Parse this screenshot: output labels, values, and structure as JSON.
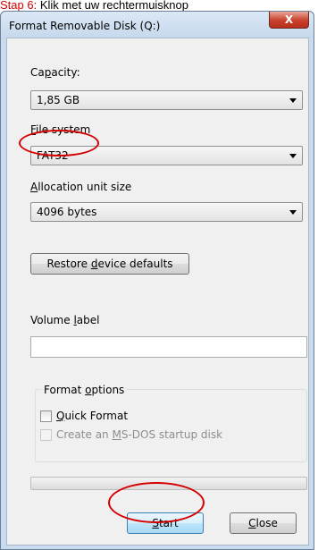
{
  "caption": {
    "step_prefix": "Stap 6:",
    "step_text": "Klik met uw rechtermuisknop"
  },
  "window": {
    "title": "Format Removable Disk (Q:)",
    "close_symbol": "X"
  },
  "capacity": {
    "label_pre": "Ca",
    "label_u": "p",
    "label_post": "acity:",
    "value": "1,85 GB"
  },
  "file_system": {
    "label_pre": "",
    "label_u": "F",
    "label_post": "ile system",
    "value": "FAT32"
  },
  "allocation": {
    "label_pre": "",
    "label_u": "A",
    "label_post": "llocation unit size",
    "value": "4096 bytes"
  },
  "restore": {
    "pre": "Restore ",
    "u": "d",
    "post": "evice defaults"
  },
  "volume": {
    "label_pre": "Volume ",
    "label_u": "l",
    "label_post": "abel",
    "value": ""
  },
  "format_options": {
    "title_pre": "Format ",
    "title_u": "o",
    "title_post": "ptions",
    "quick_pre": "",
    "quick_u": "Q",
    "quick_post": "uick Format",
    "msdos_pre": "Create an ",
    "msdos_u": "M",
    "msdos_post": "S-DOS startup disk",
    "quick_checked": false,
    "msdos_checked": false
  },
  "buttons": {
    "start_u": "S",
    "start_post": "tart",
    "close_u": "C",
    "close_post": "lose"
  },
  "progress": 0,
  "colors": {
    "annotation": "#d40000",
    "dialog_bg": "#f0f0f0",
    "frame": "#c9dbee"
  }
}
